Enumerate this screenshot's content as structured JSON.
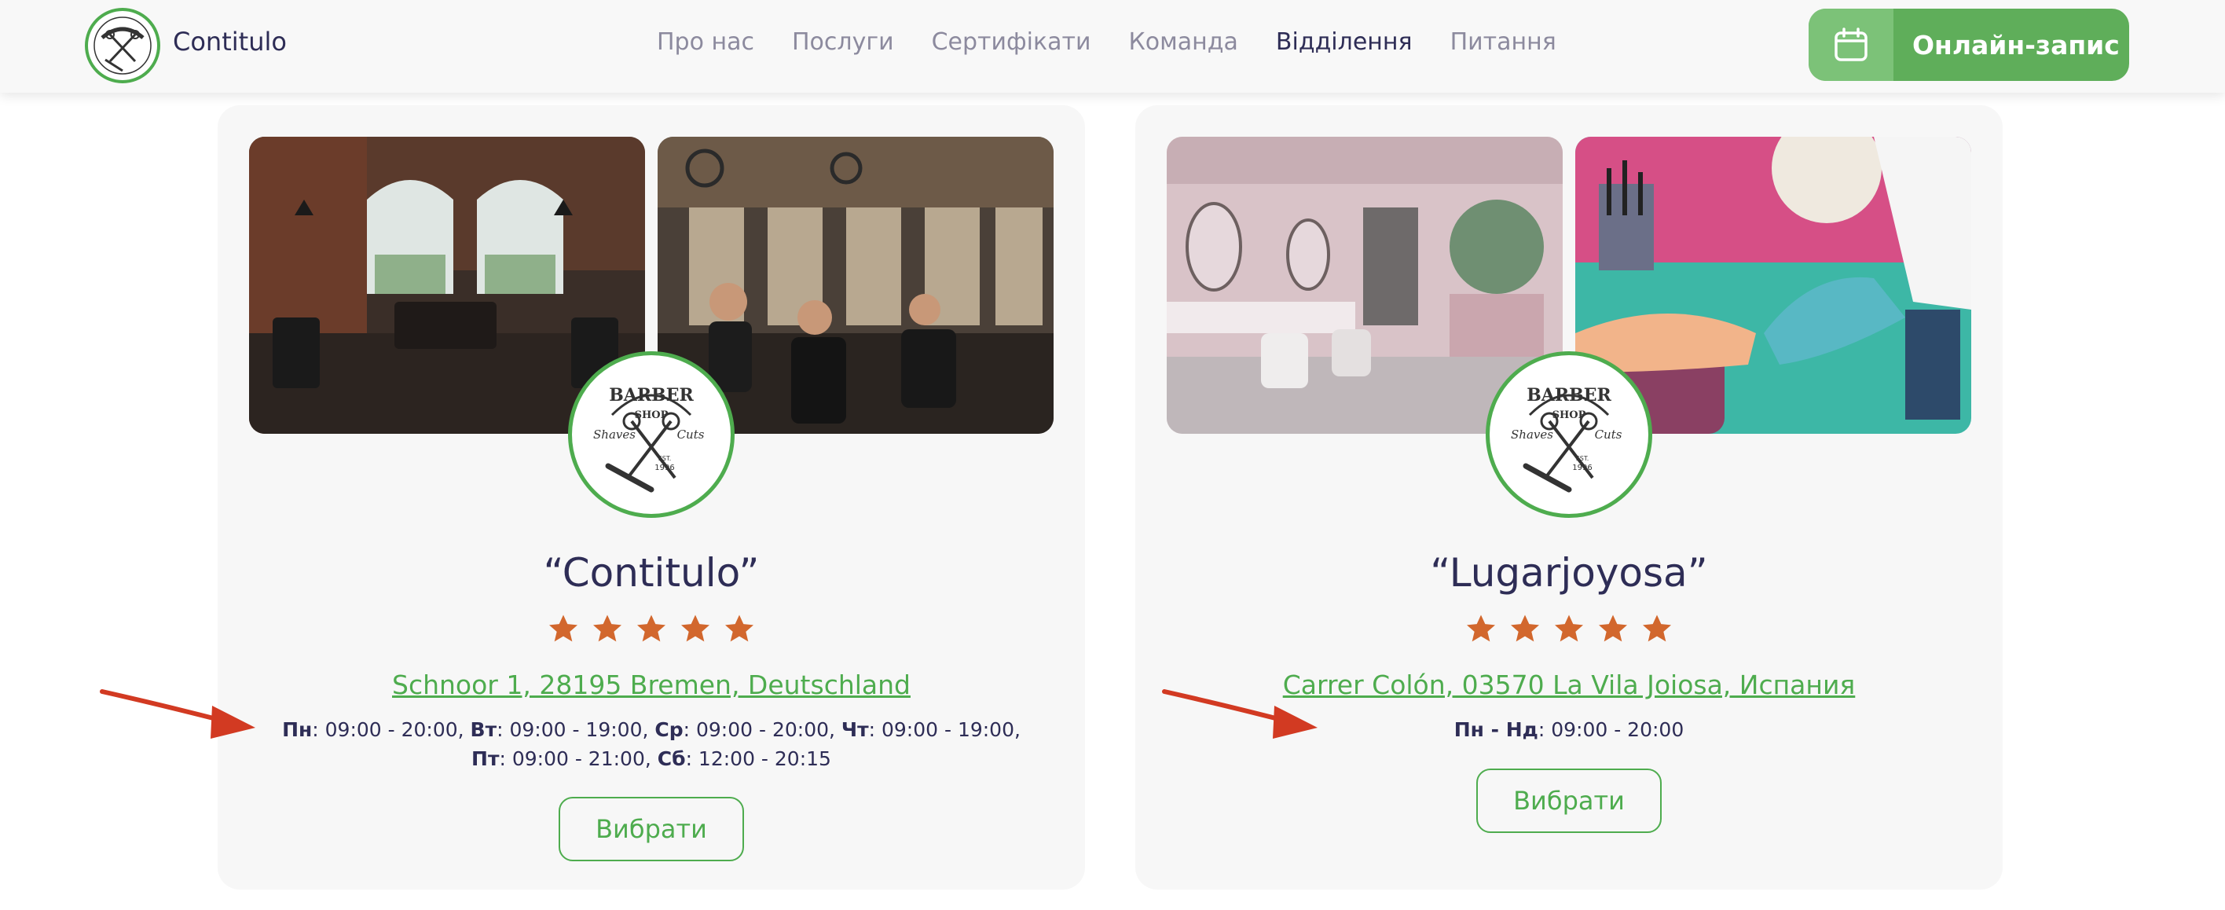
{
  "header": {
    "brand": "Contitulo",
    "nav": [
      {
        "label": "Про нас"
      },
      {
        "label": "Послуги"
      },
      {
        "label": "Сертифікати"
      },
      {
        "label": "Команда"
      },
      {
        "label": "Відділення",
        "active": true
      },
      {
        "label": "Питання"
      }
    ],
    "book_button": "Онлайн-запис"
  },
  "badge": {
    "line1": "BARBER",
    "line2": "SHOP",
    "left": "Shaves",
    "right": "Cuts",
    "est": "EST.",
    "year": "1996"
  },
  "branches": [
    {
      "title": "“Contitulo”",
      "rating": 5,
      "address": "Schnoor 1, 28195 Bremen, Deutschland",
      "hours": [
        {
          "day": "Пн",
          "time": ": 09:00 - 20:00, "
        },
        {
          "day": "Вт",
          "time": ": 09:00 - 19:00, "
        },
        {
          "day": "Ср",
          "time": ": 09:00 - 20:00, "
        },
        {
          "day": "Чт",
          "time": ": 09:00 - 19:00, "
        },
        {
          "day": "Пт",
          "time": ": 09:00 - 21:00, "
        },
        {
          "day": "Сб",
          "time": ": 12:00 - 20:15"
        }
      ],
      "button": "Вибрати"
    },
    {
      "title": "“Lugarjoyosa”",
      "rating": 5,
      "address": "Carrer Colón, 03570 La Vila Joiosa, Испания",
      "hours": [
        {
          "day": "Пн - Нд",
          "time": ": 09:00 - 20:00"
        }
      ],
      "button": "Вибрати"
    }
  ],
  "colors": {
    "accent": "#4eac4e",
    "star": "#d2672d",
    "text": "#2e2d56",
    "arrow": "#d23a22"
  },
  "icons": [
    "calendar-icon",
    "star-icon",
    "barber-shop-logo",
    "arrow-annotation"
  ]
}
